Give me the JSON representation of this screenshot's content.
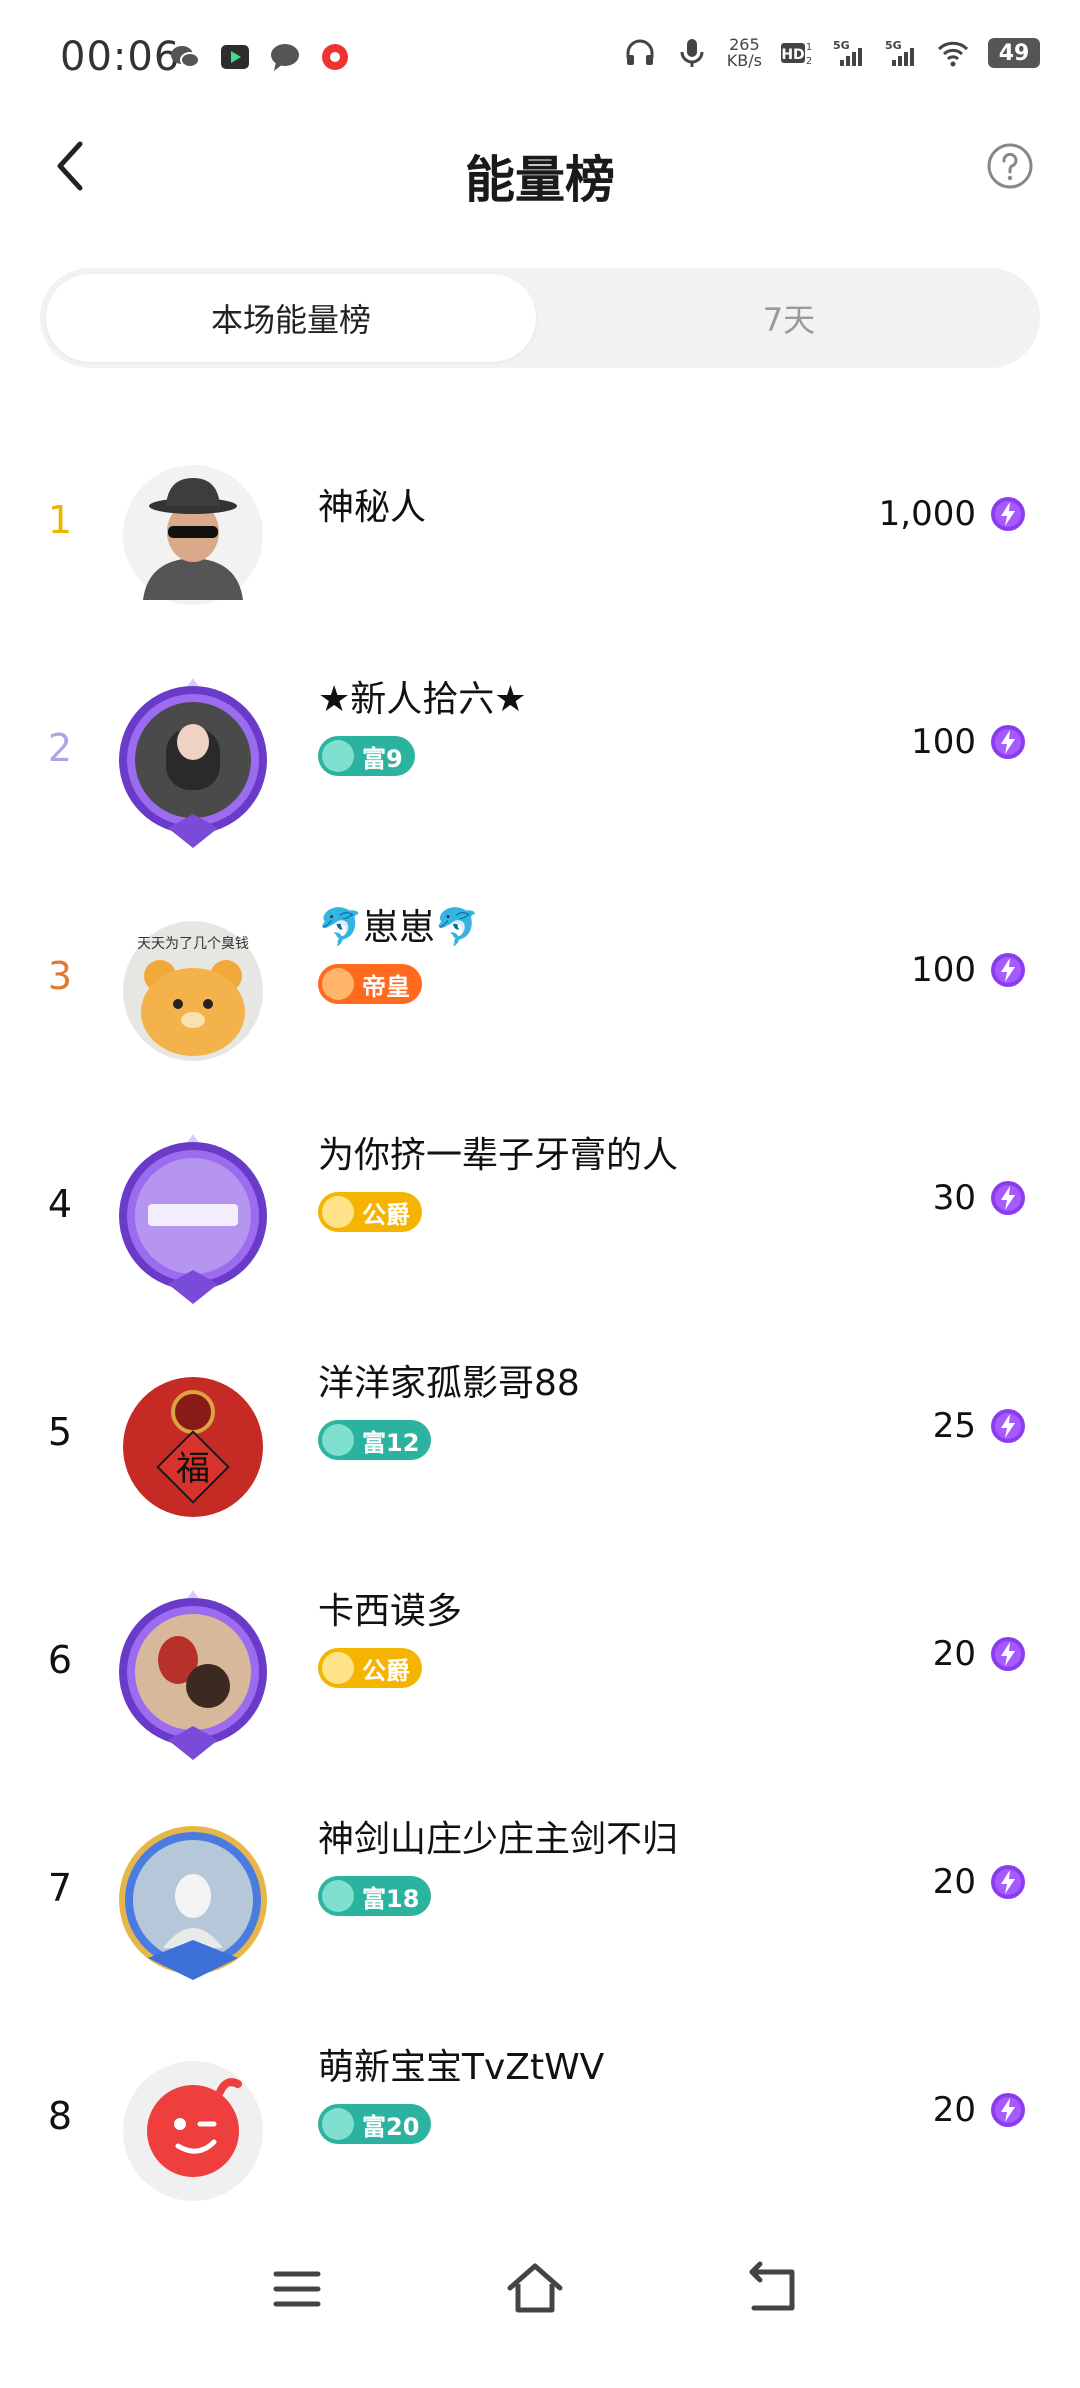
{
  "status": {
    "time": "00:06",
    "net_speed_value": "265",
    "net_speed_unit": "KB/s",
    "battery": "49",
    "signal1": "5G",
    "signal2": "5G"
  },
  "header": {
    "title": "能量榜"
  },
  "tabs": [
    {
      "label": "本场能量榜",
      "active": true
    },
    {
      "label": "7天",
      "active": false
    }
  ],
  "colors": {
    "rank1": "#f0b400",
    "rank2": "#a9a6e6",
    "rank3": "#e07a2e",
    "energy": "#8b3cf0",
    "badge_rich": "#2bb3a0",
    "badge_emperor": "#ff6a1f",
    "badge_duke": "#f5b400"
  },
  "rows": [
    {
      "rank": "1",
      "name": "神秘人",
      "badge": null,
      "badge_type": null,
      "value": "1,000",
      "avatar": "mystery-avatar"
    },
    {
      "rank": "2",
      "name": "★新人拾六★",
      "badge": "富9",
      "badge_type": "rich",
      "value": "100",
      "avatar": "frame-avatar"
    },
    {
      "rank": "3",
      "name": "崽崽",
      "name_prefix": "🐬",
      "name_suffix": "🐬",
      "badge": "帝皇",
      "badge_type": "emperor",
      "value": "100",
      "avatar": "bear-avatar"
    },
    {
      "rank": "4",
      "name": "为你挤一辈子牙膏的人",
      "badge": "公爵",
      "badge_type": "duke",
      "value": "30",
      "avatar": "frame-avatar"
    },
    {
      "rank": "5",
      "name": "洋洋家孤影哥88",
      "badge": "富12",
      "badge_type": "rich",
      "value": "25",
      "avatar": "fu-avatar"
    },
    {
      "rank": "6",
      "name": "卡西谟多",
      "badge": "公爵",
      "badge_type": "duke",
      "value": "20",
      "avatar": "frame-avatar"
    },
    {
      "rank": "7",
      "name": "神剑山庄少庄主剑不归",
      "badge": "富18",
      "badge_type": "rich",
      "value": "20",
      "avatar": "blue-frame-avatar"
    },
    {
      "rank": "8",
      "name": "萌新宝宝TvZtWV",
      "badge": "富20",
      "badge_type": "rich",
      "value": "20",
      "avatar": "wink-avatar"
    }
  ]
}
